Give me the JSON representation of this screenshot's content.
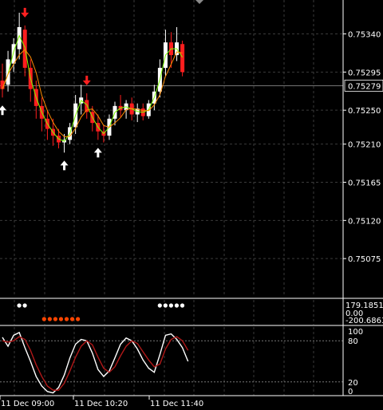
{
  "chart_data": [
    {
      "type": "candlestick",
      "panel": "main",
      "ylim": [
        0.7503,
        0.7538
      ],
      "price_labels": [
        "0.75340",
        "0.75295",
        "0.75250",
        "0.75210",
        "0.75165",
        "0.75120",
        "0.75075"
      ],
      "price_values": [
        0.7534,
        0.75295,
        0.7525,
        0.7521,
        0.75165,
        0.7512,
        0.75075
      ],
      "current_price": "0.75279",
      "current_price_value": 0.75279,
      "time_labels": [
        "11 Dec 09:00",
        "11 Dec 10:20",
        "11 Dec 11:40"
      ],
      "candles": [
        [
          0.75285,
          0.75305,
          0.75265,
          0.75275
        ],
        [
          0.7528,
          0.7532,
          0.75272,
          0.7531
        ],
        [
          0.75305,
          0.75335,
          0.75295,
          0.75328
        ],
        [
          0.75322,
          0.75365,
          0.7531,
          0.75348
        ],
        [
          0.75345,
          0.7535,
          0.7529,
          0.753
        ],
        [
          0.753,
          0.7531,
          0.7526,
          0.75275
        ],
        [
          0.75275,
          0.75285,
          0.7524,
          0.75255
        ],
        [
          0.75255,
          0.75265,
          0.75225,
          0.7524
        ],
        [
          0.7524,
          0.7525,
          0.75215,
          0.75228
        ],
        [
          0.75228,
          0.7524,
          0.75208,
          0.7522
        ],
        [
          0.7522,
          0.75228,
          0.75205,
          0.75212
        ],
        [
          0.75212,
          0.75222,
          0.752,
          0.75215
        ],
        [
          0.75215,
          0.75235,
          0.7521,
          0.7523
        ],
        [
          0.7523,
          0.75268,
          0.75222,
          0.75258
        ],
        [
          0.75258,
          0.7528,
          0.75245,
          0.75265
        ],
        [
          0.75262,
          0.7527,
          0.7524,
          0.75248
        ],
        [
          0.75248,
          0.75255,
          0.75225,
          0.75235
        ],
        [
          0.75235,
          0.75245,
          0.75215,
          0.75225
        ],
        [
          0.75225,
          0.75232,
          0.75212,
          0.7522
        ],
        [
          0.7522,
          0.75245,
          0.75215,
          0.7524
        ],
        [
          0.7524,
          0.7526,
          0.75232,
          0.75255
        ],
        [
          0.75255,
          0.75268,
          0.75242,
          0.7525
        ],
        [
          0.7525,
          0.75262,
          0.7524,
          0.75258
        ],
        [
          0.75258,
          0.75265,
          0.75238,
          0.75245
        ],
        [
          0.75245,
          0.75258,
          0.75236,
          0.75252
        ],
        [
          0.75252,
          0.75258,
          0.75238,
          0.75243
        ],
        [
          0.75243,
          0.75262,
          0.7524,
          0.75258
        ],
        [
          0.75258,
          0.7528,
          0.7525,
          0.75272
        ],
        [
          0.75272,
          0.7531,
          0.75265,
          0.753
        ],
        [
          0.753,
          0.75345,
          0.7529,
          0.7533
        ],
        [
          0.7533,
          0.75342,
          0.753,
          0.75315
        ],
        [
          0.75315,
          0.75348,
          0.75308,
          0.7533
        ],
        [
          0.75328,
          0.75332,
          0.7529,
          0.75295
        ]
      ],
      "arrows": [
        {
          "index": 4,
          "dir": "down",
          "color": "#ff2020"
        },
        {
          "index": 15,
          "dir": "down",
          "color": "#ff2020"
        },
        {
          "index": 11,
          "dir": "up",
          "color": "#ffffff"
        },
        {
          "index": 17,
          "dir": "up",
          "color": "#ffffff"
        },
        {
          "index": 0,
          "dir": "up",
          "color": "#ffffff"
        }
      ],
      "colors": {
        "bull": "#ffffff",
        "bear": "#ff1e1e",
        "ma_fast": "#7cfc00",
        "ma_slow": "#ff8c00",
        "grid": "#3a3a3a",
        "price_line": "#9a9a9a"
      }
    },
    {
      "type": "dots",
      "panel": "indicator",
      "labels": [
        "179.1851",
        "0.00",
        "-200.6863"
      ],
      "white_dots": [
        1,
        2,
        26,
        27,
        28,
        29,
        30
      ],
      "orange_dots": [
        6,
        7,
        8,
        9,
        10,
        11,
        12
      ],
      "colors": {
        "white": "#ffffff",
        "orange": "#ff4500"
      }
    },
    {
      "type": "line",
      "panel": "stochastic",
      "ylim": [
        0,
        100
      ],
      "labels": [
        "100",
        "80",
        "20",
        "0"
      ],
      "label_values": [
        100,
        80,
        20,
        0
      ],
      "levels": [
        80,
        20
      ],
      "series": [
        {
          "values": [
            85,
            72,
            88,
            92,
            70,
            50,
            28,
            14,
            6,
            4,
            12,
            30,
            55,
            75,
            82,
            80,
            62,
            38,
            28,
            36,
            55,
            75,
            84,
            80,
            68,
            52,
            40,
            34,
            60,
            88,
            90,
            82,
            70,
            50
          ],
          "color": "#ffffff"
        },
        {
          "values": [
            80,
            78,
            80,
            86,
            82,
            66,
            45,
            28,
            14,
            8,
            8,
            18,
            36,
            56,
            72,
            80,
            74,
            56,
            40,
            34,
            42,
            58,
            72,
            80,
            76,
            64,
            52,
            42,
            46,
            68,
            82,
            86,
            80,
            66
          ],
          "color": "#b01818"
        }
      ]
    }
  ]
}
